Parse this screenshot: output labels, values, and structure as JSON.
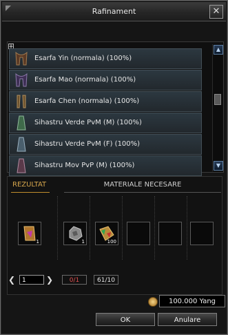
{
  "window": {
    "title": "Rafinament"
  },
  "list": {
    "items": [
      {
        "label": "Esarfa Yin (normala) (100%)",
        "icon": "scarf-icon"
      },
      {
        "label": "Esarfa Mao (normala) (100%)",
        "icon": "scarf-icon"
      },
      {
        "label": "Esarfa Chen (normala) (100%)",
        "icon": "scarf-icon"
      },
      {
        "label": "Sihastru Verde PvM (M) (100%)",
        "icon": "costume-icon"
      },
      {
        "label": "Sihastru Verde PvM (F) (100%)",
        "icon": "costume-icon"
      },
      {
        "label": "Sihastru Mov PvP (M) (100%)",
        "icon": "costume-icon"
      }
    ]
  },
  "result": {
    "label": "REZULTAT",
    "qty": "1",
    "icon": "scroll-icon"
  },
  "materials": {
    "label": "MATERIALE NECESARE",
    "slots": [
      {
        "qty": "1",
        "icon": "ore-icon"
      },
      {
        "qty": "100",
        "icon": "herb-scroll-icon"
      },
      {
        "qty": "",
        "icon": ""
      },
      {
        "qty": "",
        "icon": ""
      },
      {
        "qty": "",
        "icon": ""
      }
    ]
  },
  "pager": {
    "page": "1",
    "success": "0/1",
    "count": "61/10"
  },
  "cost": {
    "value": "100.000 Yang"
  },
  "buttons": {
    "ok": "OK",
    "cancel": "Anulare"
  },
  "colors": {
    "accent": "#d6a64d",
    "success_red": "#e05050"
  }
}
